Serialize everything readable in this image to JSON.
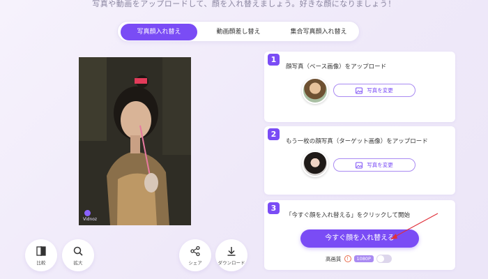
{
  "intro_text": "写真や動画をアップロードして、顔を入れ替えましょう。好きな顔になりましょう！",
  "tabs": [
    {
      "label": "写真顔入れ替え",
      "active": true
    },
    {
      "label": "動画顔差し替え",
      "active": false
    },
    {
      "label": "集合写真顔入れ替え",
      "active": false
    }
  ],
  "preview": {
    "watermark": "Vidnoz"
  },
  "actions": {
    "compare": {
      "label": "比較",
      "icon": "compare-icon"
    },
    "zoom": {
      "label": "拡大",
      "icon": "search-icon"
    },
    "share": {
      "label": "シェア",
      "icon": "share-icon"
    },
    "download": {
      "label": "ダウンロード",
      "icon": "download-icon"
    }
  },
  "steps": [
    {
      "number": "1",
      "title": "顔写真（ベース画像）をアップロード",
      "button": "写真を変更"
    },
    {
      "number": "2",
      "title": "もう一枚の顔写真（ターゲット画像）をアップロード",
      "button": "写真を変更"
    },
    {
      "number": "3",
      "title": "「今すぐ顔を入れ替える」をクリックして開始",
      "button": "今すぐ顔を入れ替える"
    }
  ],
  "quality": {
    "label": "高画質",
    "badge": "1080P",
    "enabled": false
  },
  "colors": {
    "accent": "#7a4cf5",
    "accent_light": "#a98af2",
    "annotation_arrow": "#e0303a"
  }
}
